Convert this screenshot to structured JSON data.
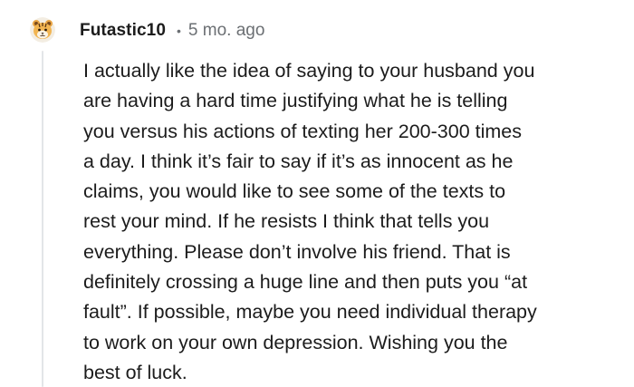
{
  "comment": {
    "author": "Futastic10",
    "separator": "•",
    "age": "5 mo. ago",
    "avatar_icon": "tiger-avatar-icon",
    "lines": [
      "I actually like the idea of saying to your husband you",
      "are having a hard time justifying what he is telling",
      "you versus his actions of texting her 200-300 times",
      "a day. I think it’s fair to say if it’s as innocent as he",
      "claims, you would like to see some of the texts to",
      "rest your mind. If he resists I think that tells you",
      "everything. Please don’t involve his friend. That is",
      "definitely crossing a huge line and then puts you “at",
      "fault”. If possible, maybe you need individual therapy",
      "to work on your own depression. Wishing you the",
      "best of luck."
    ]
  },
  "colors": {
    "author": "#1c1c1c",
    "meta": "#6b6f73",
    "thread_line": "#e3e5e8"
  }
}
